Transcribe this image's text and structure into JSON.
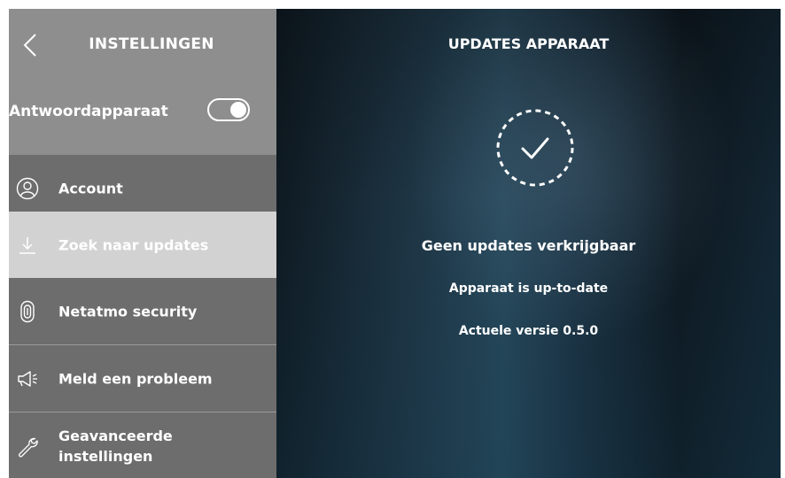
{
  "sidebar": {
    "title": "INSTELLINGEN",
    "toggle": {
      "label": "Antwoordapparaat",
      "state": "on"
    },
    "items": [
      {
        "label": "Account",
        "icon": "user-circle-icon"
      },
      {
        "label": "Zoek naar updates",
        "icon": "download-icon",
        "active": true
      },
      {
        "label": "Netatmo security",
        "icon": "netatmo-security-icon"
      },
      {
        "label": "Meld een probleem",
        "icon": "megaphone-icon"
      },
      {
        "label": "Geavanceerde instellingen",
        "icon": "wrench-icon"
      }
    ]
  },
  "main": {
    "title": "UPDATES APPARAAT",
    "status_icon": "check-circle-icon",
    "headline": "Geen updates verkrijgbaar",
    "status": "Apparaat is up-to-date",
    "version": "Actuele versie 0.5.0"
  },
  "colors": {
    "sidebar_header": "#8e8e8e",
    "sidebar": "#6d6d6d",
    "active_item": "#d2d2d2",
    "text": "#ffffff",
    "main_background": "#1d3342"
  }
}
